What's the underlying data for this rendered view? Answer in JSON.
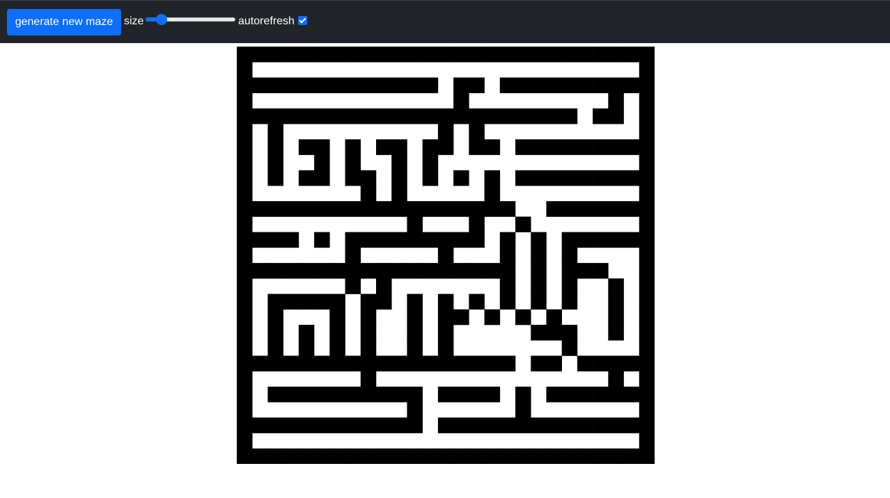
{
  "toolbar": {
    "generate_label": "generate new maze",
    "size_label": "size",
    "size_value": 0.13,
    "autorefresh_label": "autorefresh",
    "autorefresh_checked": true
  },
  "colors": {
    "toolbar_bg": "#212529",
    "accent": "#0d6efd",
    "wall": "#000000",
    "path": "#ffffff"
  },
  "maze": {
    "rows": [
      "###########################",
      "#.........................#",
      "#############.##.##########",
      "#.............#.........#.#",
      "######################.##.#",
      "#.#..........#.#..........#",
      "#.#.##.#.##.##.##.#########",
      "#.#..#.#..#.#.............#",
      "#.#.##.##.#.#.#.#.#########",
      "#.......#.#.....#.........#",
      "##################..#######",
      "#..........#...#..#.......#",
      "####.#.#########.#.#.######",
      "#......#.....#...#.#.#....#",
      "##################.#.###..#",
      "#......#.#.......#.#.#..#.#",
      "#.#####.##.#.#.#.#.#.#..#.#",
      "#.#...#.#..#.##.#.#.#...#.#",
      "#.#.#.#.#..#.#.....###..#.#",
      "#.#.#.#.#..#.#.......#....#",
      "##################.##.#####",
      "#.......#...............#.#",
      "#.##########.####.#.#######",
      "#..........#......#.......#",
      "############.##############",
      "#.........................#",
      "###########################"
    ]
  }
}
